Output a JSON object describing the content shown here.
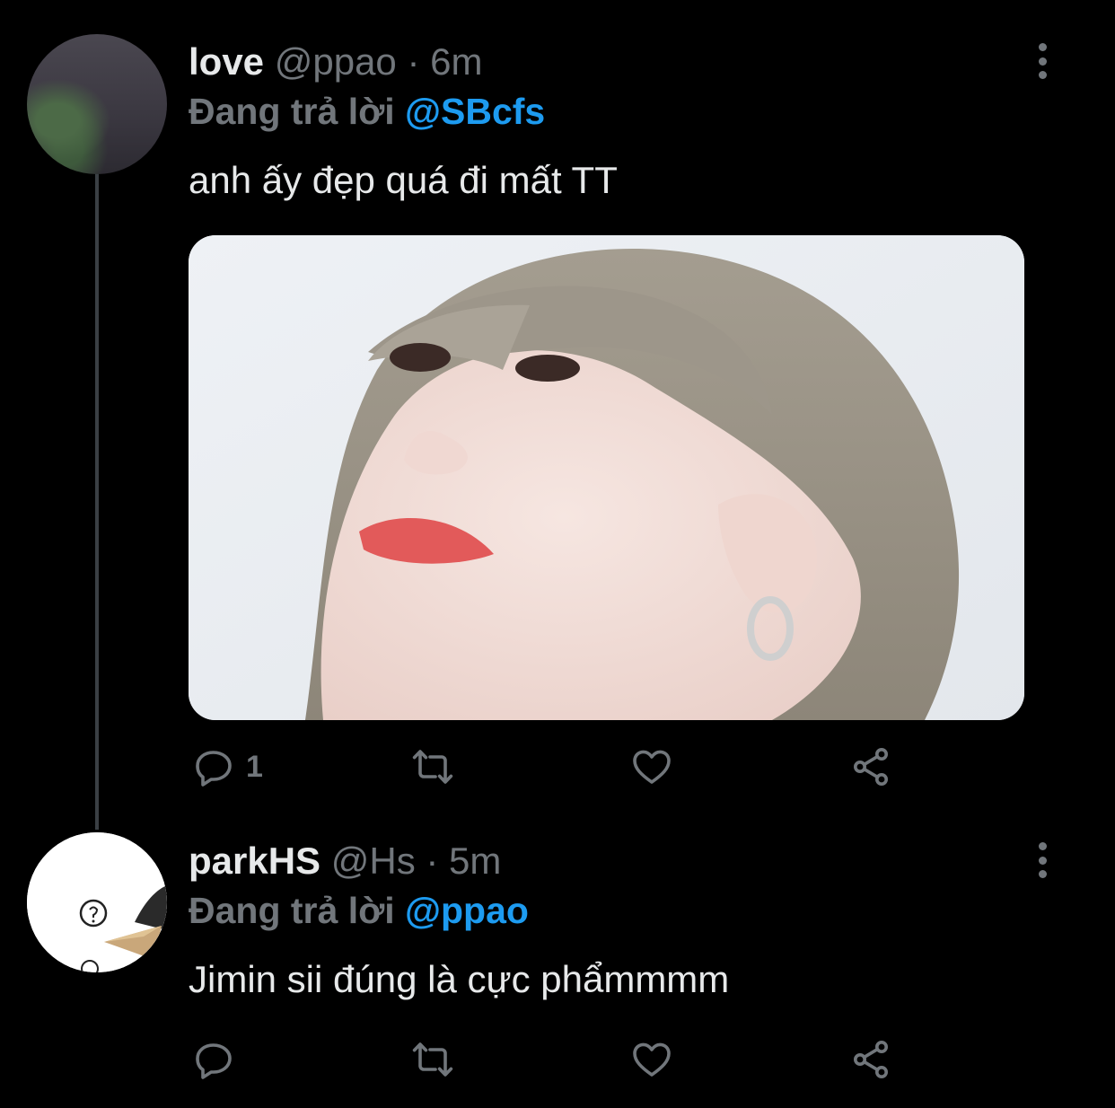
{
  "tweets": [
    {
      "name": "love",
      "handle": "@ppao",
      "time": "6m",
      "reply_prefix": "Đang trả lời",
      "reply_to": "@SBcfs",
      "text": "anh ấy đẹp quá đi mất TT",
      "reply_count": "1",
      "has_media": true
    },
    {
      "name": "parkHS",
      "handle": "@Hs",
      "time": "5m",
      "reply_prefix": "Đang trả lời",
      "reply_to": "@ppao",
      "text": "Jimin sii đúng là cực phẩmmmm",
      "reply_count": "",
      "has_media": false
    }
  ],
  "icons": [
    "reply-icon",
    "retweet-icon",
    "like-icon",
    "share-icon",
    "more-icon"
  ],
  "colors": {
    "background": "#000000",
    "mention": "#1d9bf0",
    "muted": "#71767b",
    "text": "#e7e9ea"
  }
}
